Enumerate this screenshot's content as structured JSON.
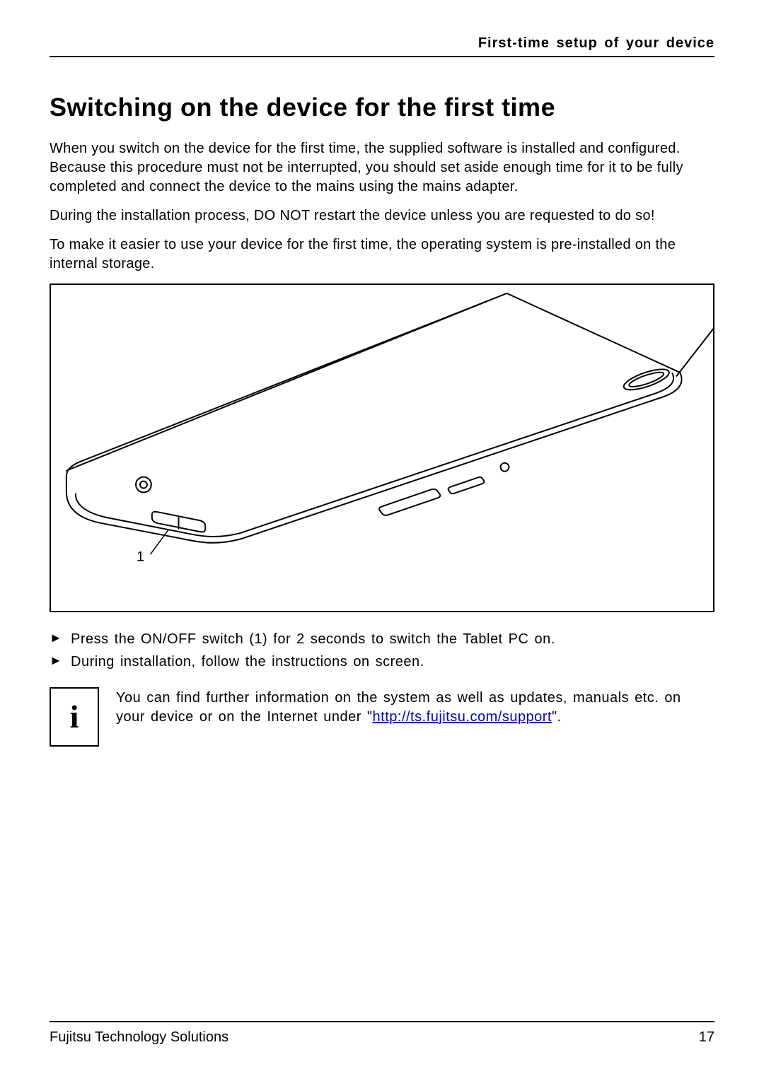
{
  "header": {
    "section": "First-time setup of your device"
  },
  "title": "Switching on the device for the first time",
  "paragraphs": {
    "p1": "When you switch on the device for the first time, the supplied software is installed and configured. Because this procedure must not be interrupted, you should set aside enough time for it to be fully completed and connect the device to the mains using the mains adapter.",
    "p2": "During the installation process, DO NOT restart the device unless you are requested to do so!",
    "p3": "To make it easier to use your device for the first time, the operating system is pre-installed on the internal storage."
  },
  "figure": {
    "callout": "1"
  },
  "steps": [
    "Press the ON/OFF switch (1) for 2 seconds to switch the Tablet PC on.",
    "During installation, follow the instructions on screen."
  ],
  "info": {
    "text_before": "You can find further information on the system as well as updates, manuals etc. on your device or on the Internet under ",
    "link_text": "http://ts.fujitsu.com/support",
    "link_href": "http://ts.fujitsu.com/support",
    "text_after": "."
  },
  "footer": {
    "left": "Fujitsu Technology Solutions",
    "right": "17"
  }
}
